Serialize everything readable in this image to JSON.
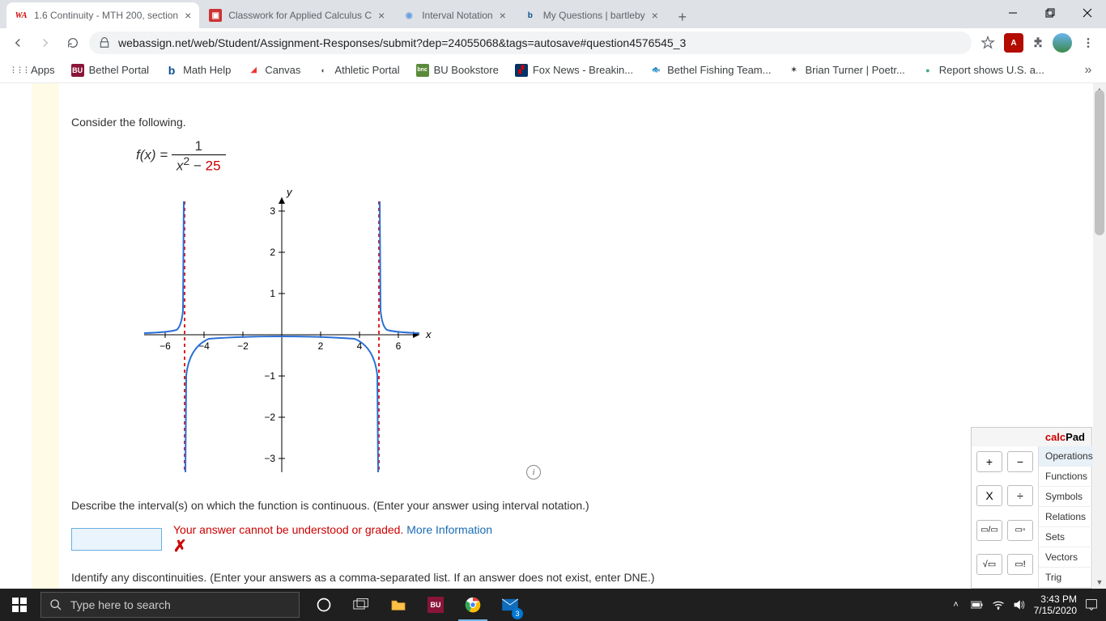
{
  "tabs": [
    {
      "title": "1.6 Continuity - MTH 200, section",
      "favicon_text": "WA",
      "favicon_bg": "#fff",
      "favicon_color": "#c00",
      "active": true
    },
    {
      "title": "Classwork for Applied Calculus C",
      "favicon_text": "▣",
      "favicon_bg": "#c33",
      "favicon_color": "#fff",
      "active": false
    },
    {
      "title": "Interval Notation",
      "favicon_text": "◉",
      "favicon_bg": "#fff",
      "favicon_color": "#6aa0e0",
      "active": false
    },
    {
      "title": "My Questions | bartleby",
      "favicon_text": "b",
      "favicon_bg": "#fff",
      "favicon_color": "#0b4f8f",
      "active": false
    }
  ],
  "url": "webassign.net/web/Student/Assignment-Responses/submit?dep=24055068&tags=autosave#question4576545_3",
  "bookmarks": [
    {
      "label": "Apps",
      "icon": "⋮⋮⋮",
      "bg": "",
      "color": "#5f6368"
    },
    {
      "label": "Bethel Portal",
      "icon": "BU",
      "bg": "#8a1538",
      "color": "#fff"
    },
    {
      "label": "Math Help",
      "icon": "b",
      "bg": "#fff",
      "color": "#0b4f8f"
    },
    {
      "label": "Canvas",
      "icon": "◢",
      "bg": "#333",
      "color": "#e33"
    },
    {
      "label": "Athletic Portal",
      "icon": "◐",
      "bg": "#fff",
      "color": "#555"
    },
    {
      "label": "BU Bookstore",
      "icon": "bnc",
      "bg": "#5a8a3a",
      "color": "#fff"
    },
    {
      "label": "Fox News - Breakin...",
      "icon": "▞",
      "bg": "#003366",
      "color": "#c00"
    },
    {
      "label": "Bethel Fishing Team...",
      "icon": "🐟",
      "bg": "",
      "color": ""
    },
    {
      "label": "Brian Turner | Poetr...",
      "icon": "✶",
      "bg": "",
      "color": "#333"
    },
    {
      "label": "Report shows U.S. a...",
      "icon": "●",
      "bg": "",
      "color": "#4a7"
    }
  ],
  "question": {
    "consider": "Consider the following.",
    "fx": "f(x) = ",
    "num": "1",
    "den_left": "x",
    "den_exp": "2",
    "den_minus": " − ",
    "den_right": "25",
    "describe": "Describe the interval(s) on which the function is continuous. (Enter your answer using interval notation.)",
    "error": "Your answer cannot be understood or graded. ",
    "error_link": "More Information",
    "identify": "Identify any discontinuities. (Enter your answers as a comma-separated list. If an answer does not exist, enter DNE.)"
  },
  "chart_data": {
    "type": "line",
    "title": "",
    "xlabel": "x",
    "ylabel": "y",
    "xlim": [
      -7,
      7
    ],
    "ylim": [
      -3.2,
      3.2
    ],
    "xticks": [
      -6,
      -4,
      -2,
      2,
      4,
      6
    ],
    "yticks": [
      -3,
      -2,
      -1,
      1,
      2,
      3
    ],
    "asymptotes_vertical": [
      -5,
      5
    ],
    "series": [
      {
        "name": "f(x)=1/(x^2-25)",
        "region": "x<-5",
        "x": [
          -7,
          -6.5,
          -6,
          -5.7,
          -5.4,
          -5.2,
          -5.05
        ],
        "y": [
          0.042,
          0.069,
          0.091,
          0.134,
          0.24,
          0.49,
          1.96
        ]
      },
      {
        "name": "f(x)=1/(x^2-25)",
        "region": "-5<x<5",
        "x": [
          -4.95,
          -4.8,
          -4.5,
          -4,
          -3,
          -2,
          0,
          2,
          3,
          4,
          4.5,
          4.8,
          4.95
        ],
        "y": [
          -2.01,
          -0.51,
          -0.21,
          -0.111,
          -0.063,
          -0.048,
          -0.04,
          -0.048,
          -0.063,
          -0.111,
          -0.21,
          -0.51,
          -2.01
        ]
      },
      {
        "name": "f(x)=1/(x^2-25)",
        "region": "x>5",
        "x": [
          5.05,
          5.2,
          5.4,
          5.7,
          6,
          6.5,
          7
        ],
        "y": [
          1.96,
          0.49,
          0.24,
          0.134,
          0.091,
          0.069,
          0.042
        ]
      }
    ]
  },
  "calcpad": {
    "title_pre": "calc",
    "title_post": "Pad",
    "btns": [
      "+",
      "−",
      "X",
      "÷",
      "▭/▭",
      "▭▫",
      "√▭",
      "▭!"
    ],
    "cats": [
      "Operations",
      "Functions",
      "Symbols",
      "Relations",
      "Sets",
      "Vectors",
      "Trig"
    ]
  },
  "taskbar": {
    "search_placeholder": "Type here to search",
    "time": "3:43 PM",
    "date": "7/15/2020",
    "mail_badge": "3"
  }
}
